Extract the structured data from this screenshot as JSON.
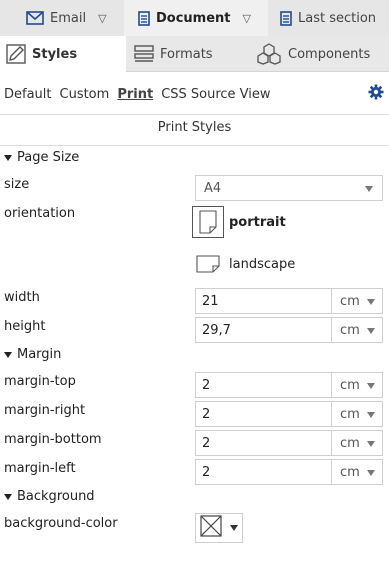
{
  "top_tabs": [
    {
      "label": "Email"
    },
    {
      "label": "Document"
    },
    {
      "label": "Last section"
    }
  ],
  "sub_tabs": [
    {
      "label": "Styles"
    },
    {
      "label": "Formats"
    },
    {
      "label": "Components"
    }
  ],
  "modes": {
    "default": "Default",
    "custom": "Custom",
    "print": "Print",
    "css_source": "CSS Source View",
    "active": "Print"
  },
  "panel_title": "Print Styles",
  "page_size": {
    "heading": "Page Size",
    "size_label": "size",
    "size_value": "A4",
    "orientation_label": "orientation",
    "portrait_label": "portrait",
    "landscape_label": "landscape",
    "selected_orientation": "portrait",
    "width_label": "width",
    "width_value": "21",
    "width_unit": "cm",
    "height_label": "height",
    "height_value": "29,7",
    "height_unit": "cm"
  },
  "margin": {
    "heading": "Margin",
    "top_label": "margin-top",
    "top_value": "2",
    "top_unit": "cm",
    "right_label": "margin-right",
    "right_value": "2",
    "right_unit": "cm",
    "bottom_label": "margin-bottom",
    "bottom_value": "2",
    "bottom_unit": "cm",
    "left_label": "margin-left",
    "left_value": "2",
    "left_unit": "cm"
  },
  "background": {
    "heading": "Background",
    "color_label": "background-color",
    "color_value": "none"
  },
  "colors": {
    "tab_bar": "#e6e6e6",
    "active_tab": "#f0f0f0",
    "icon_blue": "#1f4b8f",
    "border": "#cfcfcf"
  }
}
